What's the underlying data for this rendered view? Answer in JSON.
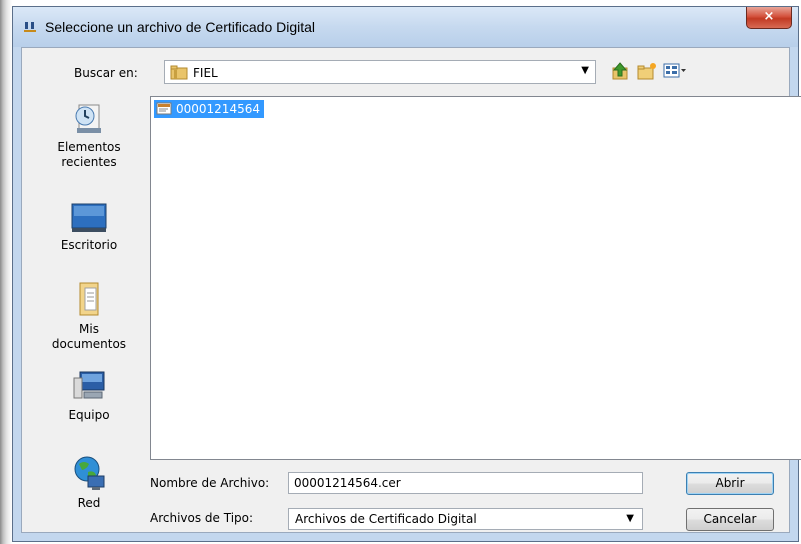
{
  "window": {
    "title": "Seleccione un archivo de Certificado Digital",
    "close_symbol": "×"
  },
  "look_in": {
    "label": "Buscar en:",
    "value": "FIEL"
  },
  "toolbar": {
    "icons": [
      "up-folder-icon",
      "new-folder-icon",
      "view-menu-icon"
    ]
  },
  "places": [
    {
      "name": "Elementos recientes",
      "label_lines": [
        "Elementos",
        "recientes"
      ],
      "icon": "recent-items-icon"
    },
    {
      "name": "Escritorio",
      "label_lines": [
        "Escritorio"
      ],
      "icon": "desktop-icon"
    },
    {
      "name": "Mis documentos",
      "label_lines": [
        "Mis",
        "documentos"
      ],
      "icon": "documents-icon"
    },
    {
      "name": "Equipo",
      "label_lines": [
        "Equipo"
      ],
      "icon": "computer-icon"
    },
    {
      "name": "Red",
      "label_lines": [
        "Red"
      ],
      "icon": "network-icon"
    }
  ],
  "files": [
    {
      "name": "00001214564",
      "selected": true,
      "icon": "certificate-file-icon"
    }
  ],
  "file_name": {
    "label": "Nombre de Archivo:",
    "value": "00001214564.cer"
  },
  "file_type": {
    "label": "Archivos de Tipo:",
    "value": "Archivos de Certificado Digital"
  },
  "buttons": {
    "open": "Abrir",
    "cancel": "Cancelar"
  },
  "colors": {
    "selection": "#3399ff",
    "titlebar": "#c3d7ee",
    "close_button": "#c23a23"
  }
}
